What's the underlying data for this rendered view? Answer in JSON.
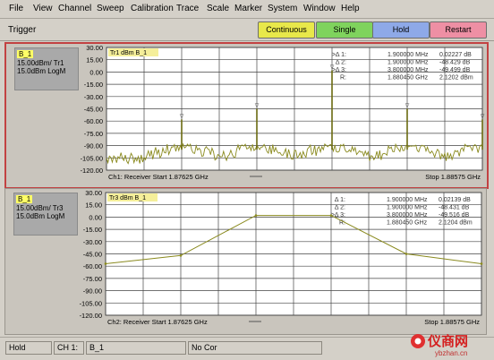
{
  "menu": [
    "File",
    "View",
    "Channel",
    "Sweep",
    "Calibration",
    "Trace",
    "Scale",
    "Marker",
    "System",
    "Window",
    "Help"
  ],
  "toolbar": {
    "label": "Trigger",
    "buttons": [
      {
        "label": "Continuous",
        "color": "#e8e84a"
      },
      {
        "label": "Single",
        "color": "#7fd35d"
      },
      {
        "label": "Hold",
        "color": "#8ea9e8"
      },
      {
        "label": "Restart",
        "color": "#ee8fa4"
      }
    ]
  },
  "channel1": {
    "info": {
      "id": "B_1",
      "line1": "15.00dBm/ Tr1",
      "line2": "15.0dBm LogM"
    },
    "trace_label": "Tr1 dBm B_1",
    "y_ticks": [
      "30.00",
      "15.00",
      "0.00",
      "-15.00",
      "-30.00",
      "-45.00",
      "-60.00",
      "-75.00",
      "-90.00",
      "-105.00",
      "-120.00"
    ],
    "markers": [
      {
        "sym": ">Δ 1:",
        "freq": "1.900000 MHz",
        "val": "0.02227 dB"
      },
      {
        "sym": "Δ 2:",
        "freq": "1.900000 MHz",
        "val": "-48.429 dB"
      },
      {
        "sym": ">Δ 3:",
        "freq": "3.800000 MHz",
        "val": "-49.499 dB"
      },
      {
        "sym": "R:",
        "freq": "1.880450 GHz",
        "val": "2.1202 dBm"
      }
    ],
    "footer_left": "Ch1: Receiver Start 1.87625 GHz",
    "footer_right": "Stop 1.88575 GHz"
  },
  "channel2": {
    "info": {
      "id": "B_1",
      "line1": "15.00dBm/ Tr3",
      "line2": "15.0dBm LogM"
    },
    "trace_label": "Tr3 dBm B_1",
    "y_ticks": [
      "30.00",
      "15.00",
      "0.00",
      "-15.00",
      "-30.00",
      "-45.00",
      "-60.00",
      "-75.00",
      "-90.00",
      "-105.00",
      "-120.00"
    ],
    "markers": [
      {
        "sym": "Δ 1:",
        "freq": "1.900000 MHz",
        "val": "0.02139 dB"
      },
      {
        "sym": "Δ 2:",
        "freq": "1.900000 MHz",
        "val": "-48.431 dB"
      },
      {
        "sym": ">Δ 3:",
        "freq": "3.800000 MHz",
        "val": "-49.516 dB"
      },
      {
        "sym": "R:",
        "freq": "1.880450 GHz",
        "val": "2.1204 dBm"
      }
    ],
    "footer_left": "Ch2: Receiver Start 1.87625 GHz",
    "footer_right": "Stop 1.88575 GHz"
  },
  "status": {
    "mode": "Hold",
    "ch_label": "CH 1:",
    "ch_value": "B_1",
    "cor": "No Cor"
  },
  "watermark": {
    "text": "仪商网",
    "url": "ybzhan.cn"
  },
  "chart_data": [
    {
      "type": "line",
      "title": "Tr1 dBm B_1",
      "xlabel": "Ch1: Receiver Start 1.87625 GHz — Stop 1.88575 GHz",
      "ylabel": "dBm",
      "ylim": [
        -120,
        30
      ],
      "x_range_ghz": [
        1.87625,
        1.88575
      ],
      "series": [
        {
          "name": "Tr1",
          "description": "noise floor about -110 dBm with spurs",
          "peaks": [
            {
              "x_ghz": 1.87815,
              "y": -58
            },
            {
              "x_ghz": 1.88005,
              "y": -45
            },
            {
              "x_ghz": 1.88195,
              "y": 2
            },
            {
              "x_ghz": 1.88385,
              "y": -45
            },
            {
              "x_ghz": 1.88575,
              "y": -58
            }
          ]
        }
      ]
    },
    {
      "type": "line",
      "title": "Tr3 dBm B_1",
      "xlabel": "Ch2: Receiver Start 1.87625 GHz — Stop 1.88575 GHz",
      "ylabel": "dBm",
      "ylim": [
        -120,
        30
      ],
      "x_range_ghz": [
        1.87625,
        1.88575
      ],
      "series": [
        {
          "name": "Tr3",
          "points": [
            [
              1.87625,
              -57
            ],
            [
              1.87815,
              -47
            ],
            [
              1.88005,
              2
            ],
            [
              1.88195,
              2
            ],
            [
              1.88385,
              -45
            ],
            [
              1.88575,
              -57
            ]
          ]
        }
      ]
    }
  ]
}
